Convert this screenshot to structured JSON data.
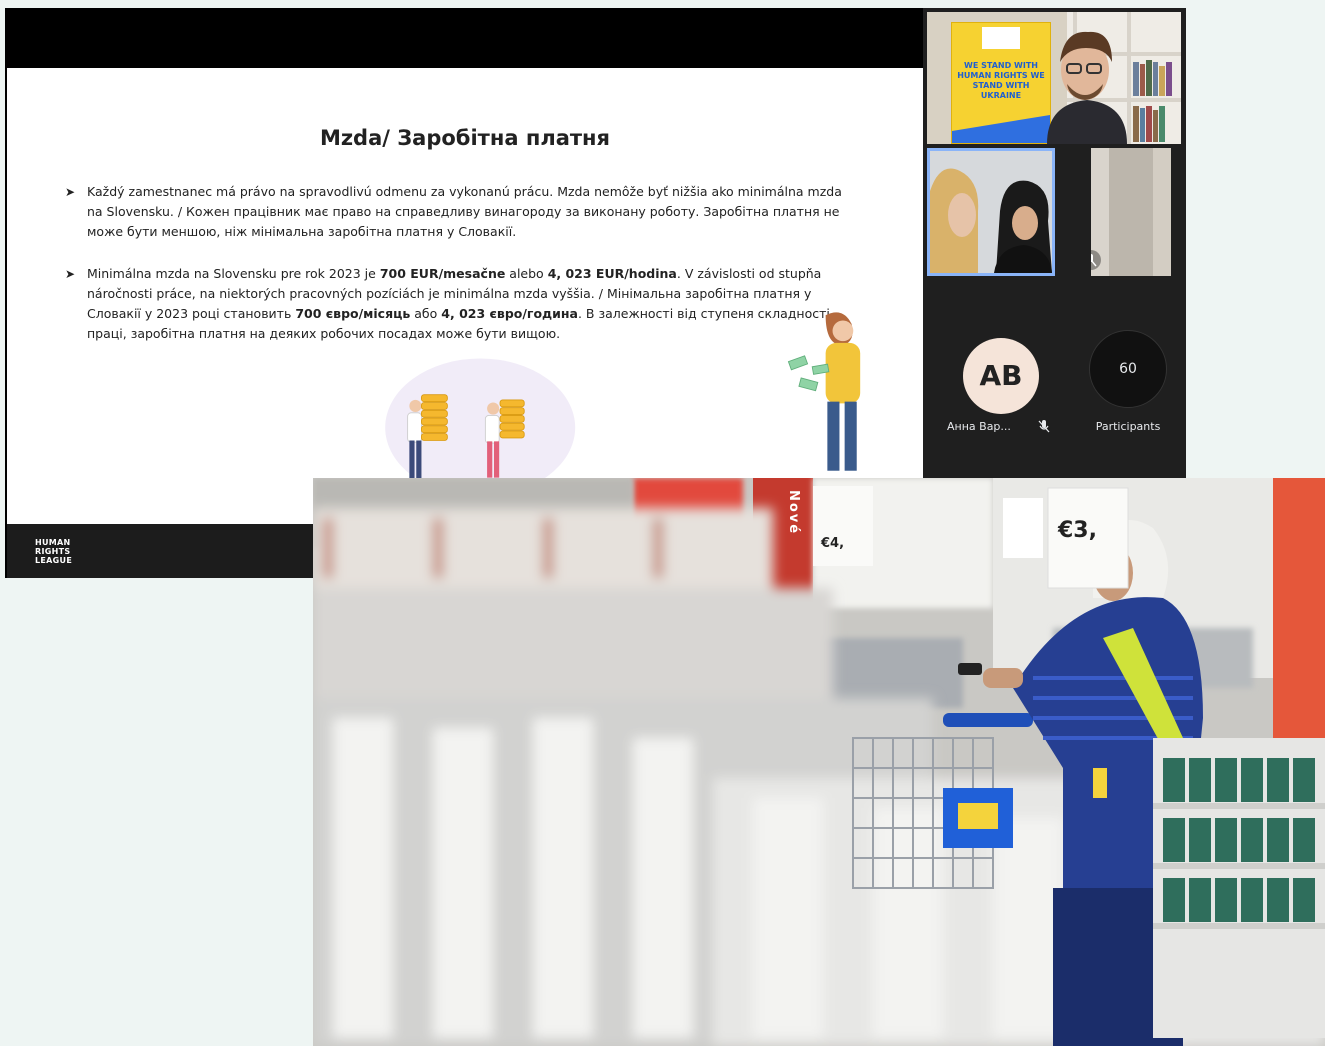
{
  "slide": {
    "title": "Mzda/ Заробітна платня",
    "bullet1": "Každý zamestnanec má právo na spravodlivú odmenu za vykonanú prácu. Mzda nemôže byť nižšia ako minimálna mzda na Slovensku. / Кожен працівник має право на справедливу винагороду за виконану роботу. Заробітна платня не може бути меншою, ніж мінімальна заробітна платня у Словакії.",
    "bullet2_part1": "Minimálna mzda na Slovensku pre rok 2023 je ",
    "bullet2_bold1": "700 EUR/mesačne",
    "bullet2_part2": " alebo ",
    "bullet2_bold2": "4, 023 EUR/hodina",
    "bullet2_part3": ". V závislosti od stupňa náročnosti práce, na niektorých pracovných pozíciách je minimálna mzda vyššia. / Мінімальна заробітна платня у Словакії у 2023 році становить ",
    "bullet2_bold3": "700 євро/місяць",
    "bullet2_part4": " або ",
    "bullet2_bold4": "4, 023 євро/година",
    "bullet2_part5": ". В залежності від ступеня складності праці, заробітна платня на деяких робочих посадах може бути вищою.",
    "logo_line1": "HUMAN",
    "logo_line2": "RIGHTS",
    "logo_line3": "LEAGUE"
  },
  "meeting": {
    "banner_text": "WE STAND WITH HUMAN RIGHTS WE STAND WITH UKRAINE",
    "participant_initials": "AB",
    "participant_name": "Анна Вар...",
    "participant_count": "60",
    "participants_label": "Participants"
  },
  "photo": {
    "sign_text": "Nové",
    "price_left": "€4,",
    "price_right": "€3,"
  },
  "colors": {
    "slide_bg": "#ffffff",
    "tile_bg": "#1f1f1f",
    "active_speaker_border": "#8ab4f8",
    "banner_yellow": "#f6d231",
    "ikea_blue": "#1f5fd1"
  }
}
